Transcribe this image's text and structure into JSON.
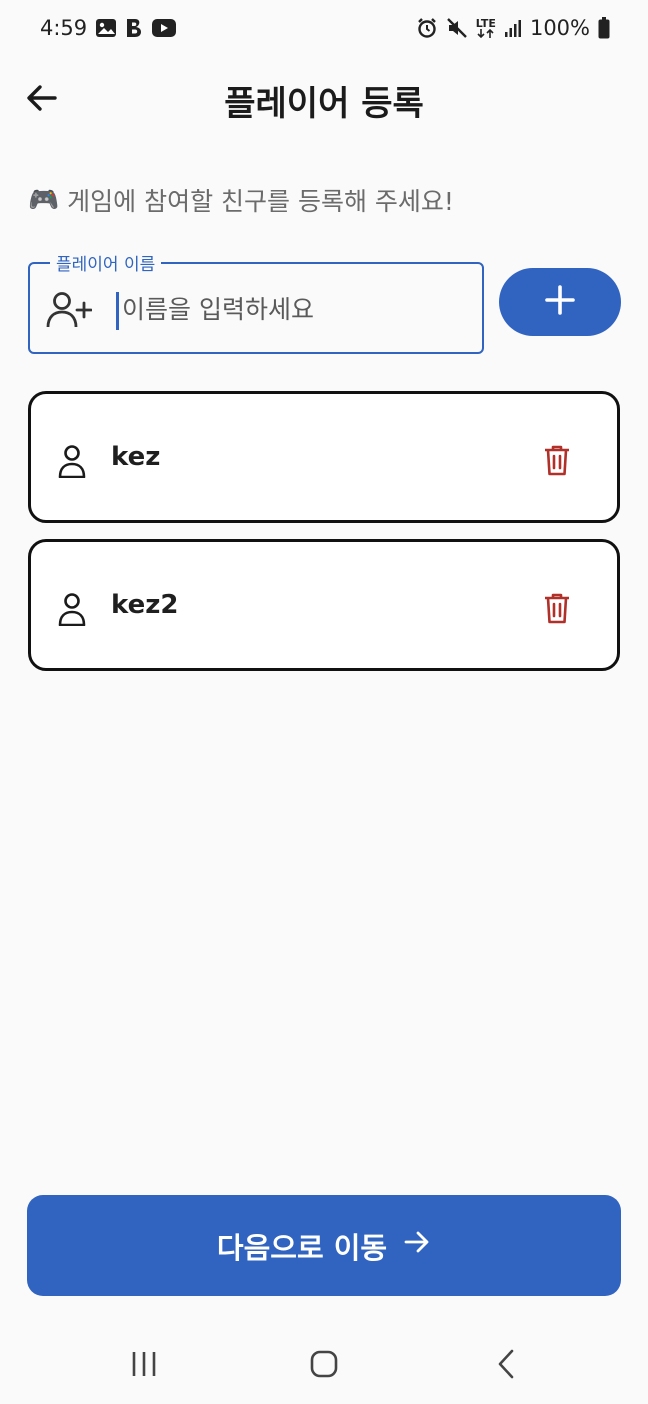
{
  "status_bar": {
    "time": "4:59",
    "left_icons": [
      "gallery-icon",
      "b-icon",
      "youtube-icon"
    ],
    "right_icons": [
      "alarm-icon",
      "mute-icon",
      "lte-icon",
      "signal-icon"
    ],
    "network": "LTE",
    "battery": "100%"
  },
  "header": {
    "title": "플레이어 등록",
    "back_icon": "arrow-left-icon"
  },
  "subtitle": {
    "emoji": "🎮",
    "text": "게임에 참여할 친구를 등록해 주세요!"
  },
  "name_field": {
    "label": "플레이어 이름",
    "placeholder": "이름을 입력하세요",
    "value": "",
    "icon": "person-add-icon"
  },
  "add_button": {
    "icon": "plus-icon"
  },
  "players": [
    {
      "name": "kez",
      "icon": "person-icon",
      "delete_icon": "trash-icon"
    },
    {
      "name": "kez2",
      "icon": "person-icon",
      "delete_icon": "trash-icon"
    }
  ],
  "next_button": {
    "label": "다음으로 이동",
    "icon": "arrow-right-icon"
  },
  "nav_bar": {
    "items": [
      "recents-icon",
      "home-icon",
      "back-icon"
    ]
  },
  "colors": {
    "primary": "#3064c0",
    "delete": "#b0302a",
    "background": "#fafafa",
    "card_border": "#111111"
  }
}
